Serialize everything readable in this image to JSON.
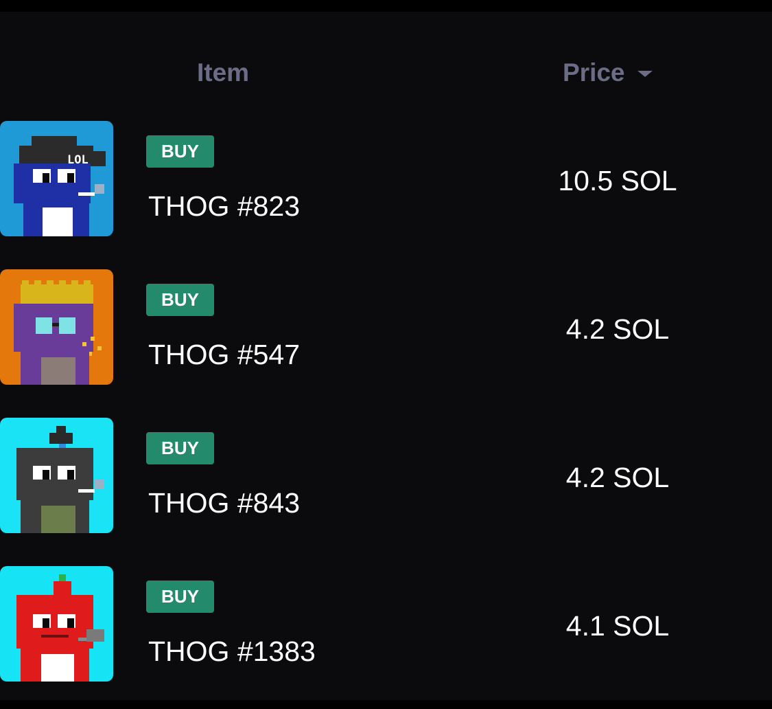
{
  "table": {
    "header": {
      "item_label": "Item",
      "price_label": "Price",
      "sort_icon": "caret-down-icon"
    },
    "rows": [
      {
        "name": "THOG #823",
        "badge": "BUY",
        "price": "10.5 SOL",
        "avatar": {
          "bg": "#1f9ad6",
          "body": "#1f2fa6",
          "accessory": "cap-lol",
          "cap_text": "LOL"
        }
      },
      {
        "name": "THOG #547",
        "badge": "BUY",
        "price": "4.2 SOL",
        "avatar": {
          "bg": "#e5780c",
          "body": "#6a3c9a",
          "accessory": "crown-glasses"
        }
      },
      {
        "name": "THOG #843",
        "badge": "BUY",
        "price": "4.2 SOL",
        "avatar": {
          "bg": "#19e3f5",
          "body": "#3c3c3c",
          "accessory": "mohawk"
        }
      },
      {
        "name": "THOG #1383",
        "badge": "BUY",
        "price": "4.1 SOL",
        "avatar": {
          "bg": "#16e4f4",
          "body": "#e01b1b",
          "accessory": "topknot"
        }
      }
    ]
  },
  "colors": {
    "background": "#0b0b0d",
    "header_text": "#6b6d86",
    "buy_badge": "#238a6c",
    "text": "#ffffff"
  }
}
